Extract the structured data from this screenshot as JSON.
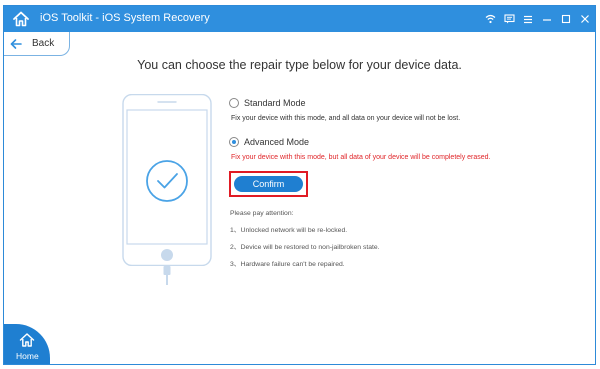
{
  "window": {
    "title": "iOS Toolkit - iOS System Recovery",
    "controls": [
      "wifi-icon",
      "feedback-icon",
      "menu-icon",
      "minimize-icon",
      "maximize-icon",
      "close-icon"
    ]
  },
  "back_label": "Back",
  "heading": "You can choose the repair type below for your device data.",
  "options": [
    {
      "label": "Standard Mode",
      "description": "Fix your device with this mode, and all data on your device will not be lost.",
      "selected": false
    },
    {
      "label": "Advanced Mode",
      "description": "Fix your device with this mode, but all data of your device will be completely erased.",
      "selected": true
    }
  ],
  "confirm_label": "Confirm",
  "attention": {
    "title": "Please pay attention:",
    "items": [
      "1、Unlocked network will be re-locked.",
      "2、Device will be restored to non-jailbroken state.",
      "3、Hardware failure can't be repaired."
    ]
  },
  "home_label": "Home",
  "colors": {
    "accent": "#2f8fde",
    "button": "#1f7fd1",
    "warning_text": "#e0262a",
    "highlight_border": "#e01b24"
  }
}
